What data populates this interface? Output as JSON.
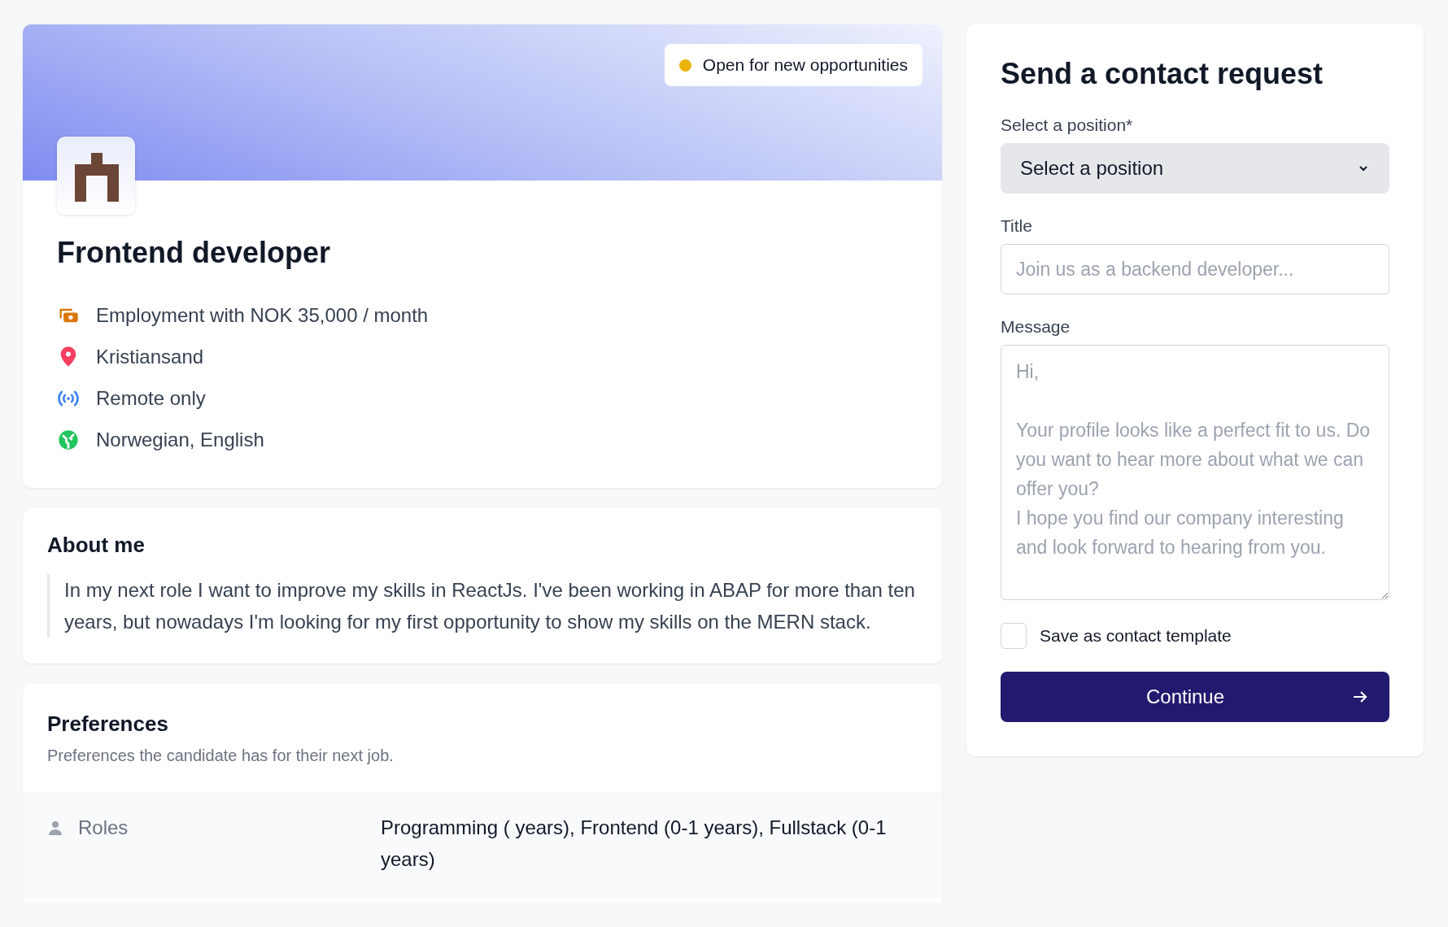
{
  "profile": {
    "status": {
      "label": "Open for new opportunities",
      "color": "#eab308"
    },
    "title": "Frontend developer",
    "details": [
      {
        "kind": "salary",
        "text": "Employment with NOK 35,000 / month"
      },
      {
        "kind": "location",
        "text": "Kristiansand"
      },
      {
        "kind": "remote",
        "text": "Remote only"
      },
      {
        "kind": "language",
        "text": "Norwegian, English"
      }
    ]
  },
  "about": {
    "heading": "About me",
    "text": "In my next role I want to improve my skills in ReactJs. I've been working in ABAP for more than ten years, but nowadays I'm looking for my first opportunity to show my skills on the MERN stack."
  },
  "preferences": {
    "heading": "Preferences",
    "subtitle": "Preferences the candidate has for their next job.",
    "rows": [
      {
        "label": "Roles",
        "value": "Programming ( years), Frontend (0-1 years), Fullstack (0-1 years)"
      }
    ]
  },
  "contact_form": {
    "heading": "Send a contact request",
    "position": {
      "label": "Select a position*",
      "value": "Select a position"
    },
    "title": {
      "label": "Title",
      "placeholder": "Join us as a backend developer..."
    },
    "message": {
      "label": "Message",
      "placeholder": "Hi,\n\nYour profile looks like a perfect fit to us. Do you want to hear more about what we can offer you?\nI hope you find our company interesting and look forward to hearing from you."
    },
    "save_template": {
      "label": "Save as contact template",
      "checked": false
    },
    "submit": "Continue"
  }
}
